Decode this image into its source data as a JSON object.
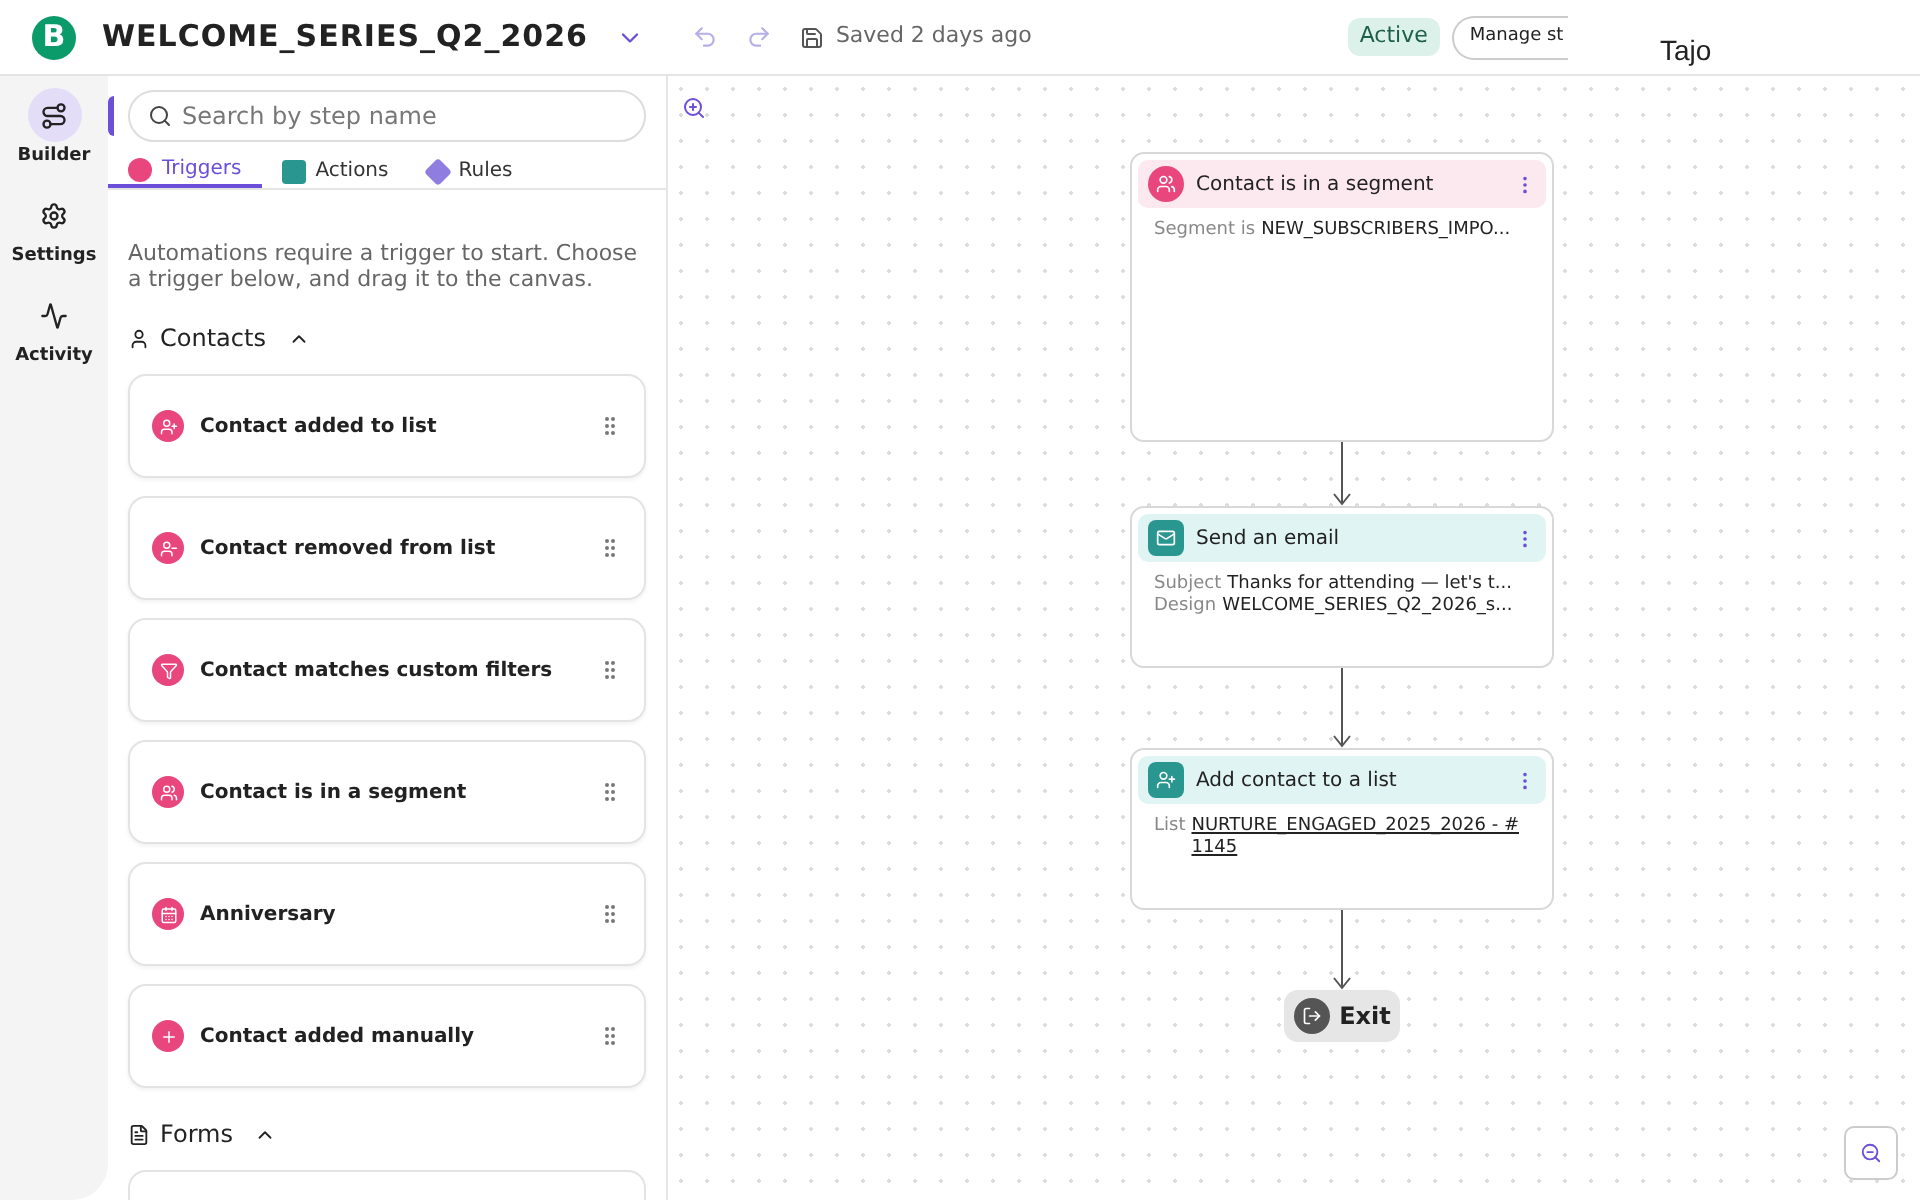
{
  "header": {
    "logo": "B",
    "title": "WELCOME_SERIES_Q2_2026",
    "saved": "Saved 2 days ago",
    "status": "Active",
    "manage_button": "Manage st"
  },
  "overlay": {
    "text": "Tajo"
  },
  "rail": [
    {
      "label": "Builder",
      "selected": true
    },
    {
      "label": "Settings",
      "selected": false
    },
    {
      "label": "Activity",
      "selected": false
    }
  ],
  "search": {
    "placeholder": "Search by step name"
  },
  "tabs": [
    {
      "label": "Triggers",
      "selected": true,
      "kind": "circle",
      "color": "#e8467c"
    },
    {
      "label": "Actions",
      "selected": false,
      "kind": "square",
      "color": "#2a9690"
    },
    {
      "label": "Rules",
      "selected": false,
      "kind": "diamond",
      "color": "#8f7ee0"
    }
  ],
  "intro": "Automations require a trigger to start. Choose a trigger below, and drag it to the canvas.",
  "sections": [
    {
      "title": "Contacts",
      "expanded": true,
      "items": [
        "Contact added to list",
        "Contact removed from list",
        "Contact matches custom filters",
        "Contact is in a segment",
        "Anniversary",
        "Contact added manually"
      ]
    },
    {
      "title": "Forms",
      "expanded": true
    }
  ],
  "nodes": [
    {
      "kind": "trigger",
      "title": "Contact is in a segment",
      "tall": true,
      "fields": [
        {
          "label": "Segment is",
          "value": "NEW_SUBSCRIBERS_IMPO...",
          "link": false
        }
      ]
    },
    {
      "kind": "action",
      "title": "Send an email",
      "tall": false,
      "fields": [
        {
          "label": "Subject",
          "value": "Thanks for attending — let's t...",
          "link": false
        },
        {
          "label": "Design",
          "value": "WELCOME_SERIES_Q2_2026_s...",
          "link": false
        }
      ]
    },
    {
      "kind": "action",
      "title": "Add contact to a list",
      "tall": false,
      "fields": [
        {
          "label": "List",
          "value": "NURTURE_ENGAGED_2025_2026 - # 1145",
          "link": true
        }
      ]
    }
  ],
  "exit": {
    "label": "Exit"
  }
}
